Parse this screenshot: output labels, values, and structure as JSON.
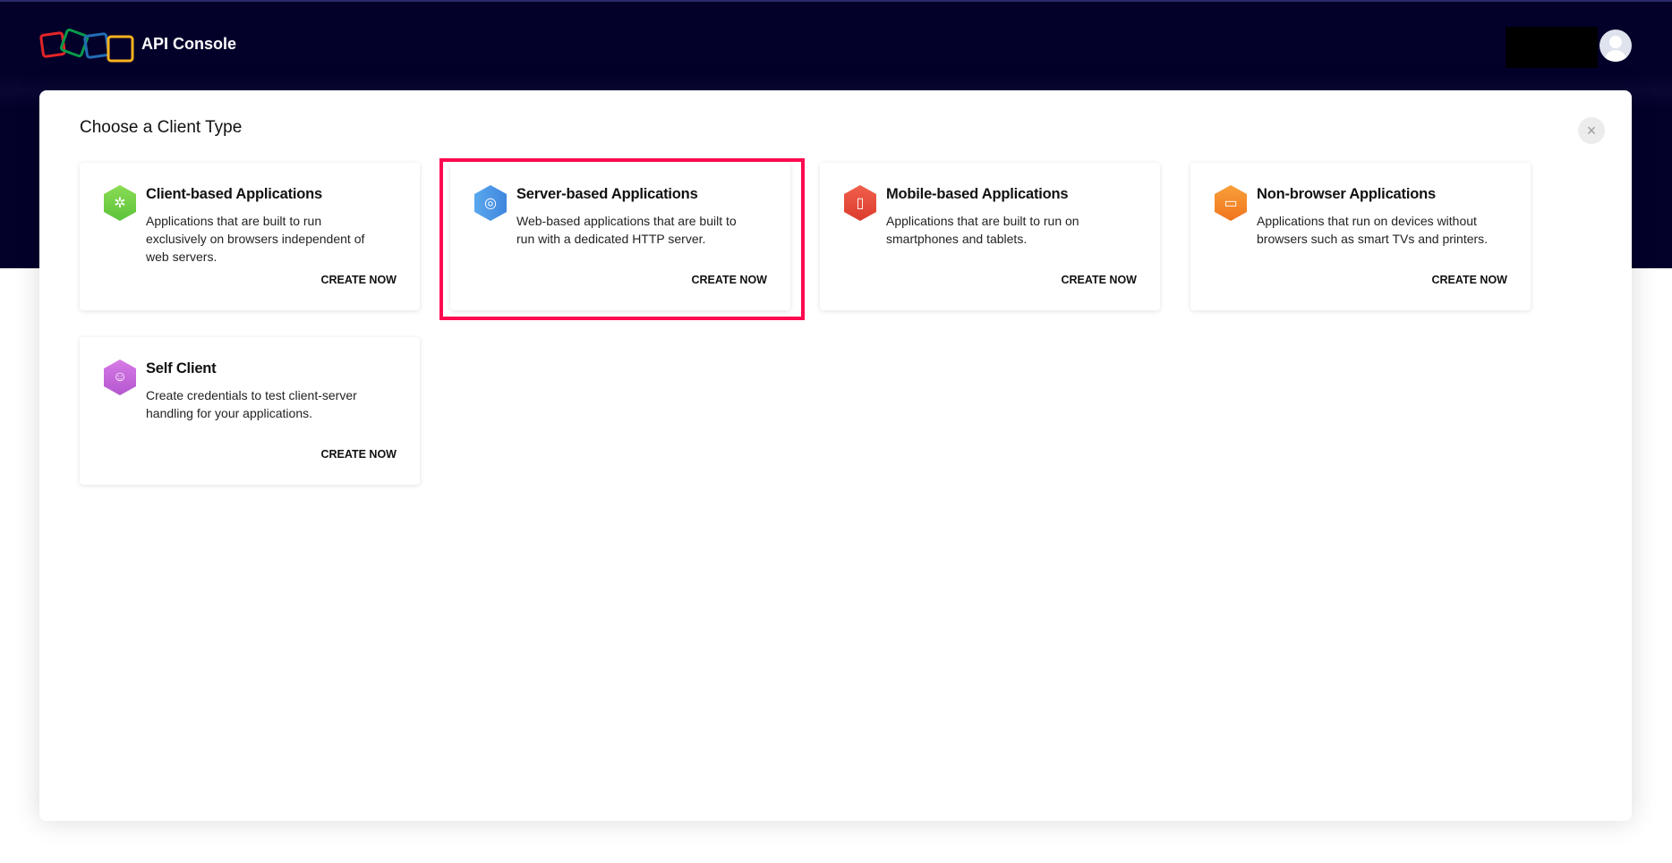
{
  "header": {
    "app_title": "API Console"
  },
  "modal": {
    "title": "Choose a Client Type",
    "close_label": "×"
  },
  "cards": [
    {
      "title": "Client-based Applications",
      "description": "Applications that are built to run exclusively on browsers independent of web servers.",
      "action": "CREATE NOW",
      "icon": "puzzle-icon",
      "color": "#6fcf4a",
      "glyph": "✲"
    },
    {
      "title": "Server-based Applications",
      "description": "Web-based applications that are built to run with a dedicated HTTP server.",
      "action": "CREATE NOW",
      "icon": "globe-icon",
      "color": "#4a90e2",
      "glyph": "🌐"
    },
    {
      "title": "Mobile-based Applications",
      "description": "Applications that are built to run on smartphones and tablets.",
      "action": "CREATE NOW",
      "icon": "mobile-icon",
      "color": "#ea4b3c",
      "glyph": "▯"
    },
    {
      "title": "Non-browser Applications",
      "description": "Applications that run on devices without browsers such as smart TVs and printers.",
      "action": "CREATE NOW",
      "icon": "tv-icon",
      "color": "#f5862a",
      "glyph": "▭"
    },
    {
      "title": "Self Client",
      "description": "Create credentials to test client-server handling for your applications.",
      "action": "CREATE NOW",
      "icon": "person-icon",
      "color": "#c265d8",
      "glyph": "☺"
    }
  ]
}
